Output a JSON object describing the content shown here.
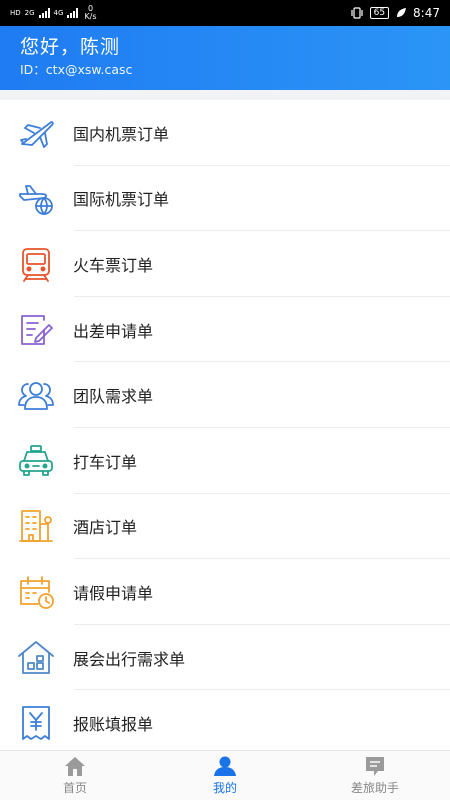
{
  "status_bar": {
    "left_hd": "HD",
    "net_1": "2G",
    "net_2": "4G",
    "speed_value": "0",
    "speed_unit": "K/s",
    "battery": "65",
    "time": "8:47"
  },
  "header": {
    "greeting": "您好，陈测",
    "user_id": "ID：ctx@xsw.casc"
  },
  "menu": {
    "items": [
      {
        "label": "国内机票订单",
        "icon": "airplane-icon",
        "color": "#3d7ed8"
      },
      {
        "label": "国际机票订单",
        "icon": "globe-airplane-icon",
        "color": "#3d7ed8"
      },
      {
        "label": "火车票订单",
        "icon": "train-icon",
        "color": "#e8542b"
      },
      {
        "label": "出差申请单",
        "icon": "form-edit-icon",
        "color": "#8a63d2"
      },
      {
        "label": "团队需求单",
        "icon": "team-icon",
        "color": "#3d7ed8"
      },
      {
        "label": "打车订单",
        "icon": "car-icon",
        "color": "#23a58e"
      },
      {
        "label": "酒店订单",
        "icon": "hotel-icon",
        "color": "#f2a22f"
      },
      {
        "label": "请假申请单",
        "icon": "calendar-clock-icon",
        "color": "#f2a22f"
      },
      {
        "label": "展会出行需求单",
        "icon": "exhibition-house-icon",
        "color": "#4f88c8"
      },
      {
        "label": "报账填报单",
        "icon": "receipt-yen-icon",
        "color": "#3d7ed8"
      }
    ]
  },
  "tabbar": {
    "tabs": [
      {
        "label": "首页",
        "icon": "home-icon"
      },
      {
        "label": "我的",
        "icon": "user-icon"
      },
      {
        "label": "差旅助手",
        "icon": "assistant-icon"
      }
    ],
    "active_index": 1,
    "active_color": "#1a73e8",
    "inactive_color": "#888888"
  }
}
